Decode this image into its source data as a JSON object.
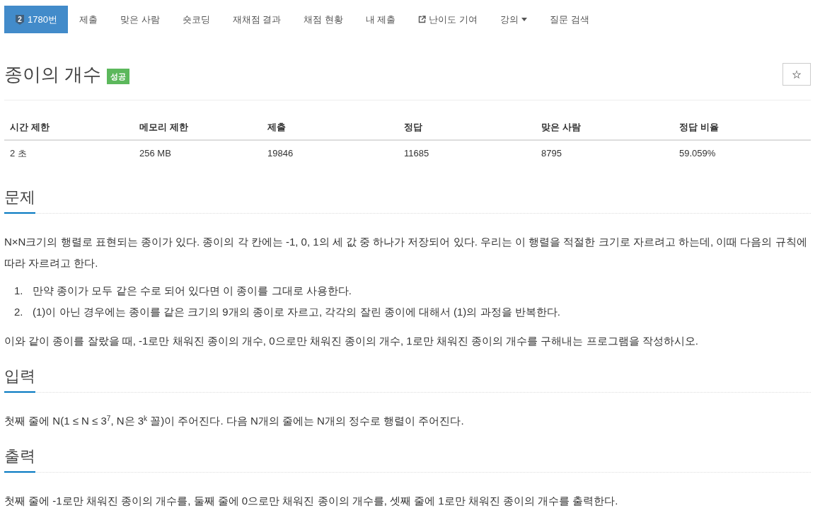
{
  "nav": {
    "tier": "2",
    "tabs": [
      {
        "label": "1780번",
        "kind": "problem",
        "selected": true
      },
      {
        "label": "제출",
        "kind": "link",
        "selected": false
      },
      {
        "label": "맞은 사람",
        "kind": "link",
        "selected": false
      },
      {
        "label": "숏코딩",
        "kind": "link",
        "selected": false
      },
      {
        "label": "재채점 결과",
        "kind": "link",
        "selected": false
      },
      {
        "label": "채점 현황",
        "kind": "link",
        "selected": false
      },
      {
        "label": "내 제출",
        "kind": "link",
        "selected": false
      },
      {
        "label": "난이도 기여",
        "kind": "external",
        "selected": false
      },
      {
        "label": "강의",
        "kind": "dropdown",
        "selected": false
      },
      {
        "label": "질문 검색",
        "kind": "link",
        "selected": false
      }
    ]
  },
  "problem": {
    "title": "종이의 개수",
    "result": "성공",
    "star": "☆"
  },
  "limits": {
    "columns": [
      "시간 제한",
      "메모리 제한",
      "제출",
      "정답",
      "맞은 사람",
      "정답 비율"
    ],
    "rows": [
      [
        "2 초",
        "256 MB",
        "19846",
        "11685",
        "8795",
        "59.059%"
      ]
    ]
  },
  "sections": [
    {
      "heading": "문제",
      "blocks": [
        {
          "kind": "paragraph",
          "text": "N×N크기의 행렬로 표현되는 종이가 있다. 종이의 각 칸에는 -1, 0, 1의 세 값 중 하나가 저장되어 있다. 우리는 이 행렬을 적절한 크기로 자르려고 하는데, 이때 다음의 규칙에 따라 자르려고 한다."
        },
        {
          "kind": "ordered_list",
          "items": [
            {
              "number": "1.",
              "text": "만약 종이가 모두 같은 수로 되어 있다면 이 종이를 그대로 사용한다."
            },
            {
              "number": "2.",
              "text": "(1)이 아닌 경우에는 종이를 같은 크기의 9개의 종이로 자르고, 각각의 잘린 종이에 대해서 (1)의 과정을 반복한다."
            }
          ]
        },
        {
          "kind": "paragraph",
          "text": "이와 같이 종이를 잘랐을 때, -1로만 채워진 종이의 개수, 0으로만 채워진 종이의 개수, 1로만 채워진 종이의 개수를 구해내는 프로그램을 작성하시오."
        }
      ]
    },
    {
      "heading": "입력",
      "blocks": [
        {
          "kind": "paragraph",
          "text": "첫째 줄에 N(1 ≤ N ≤ 3$^{7}$, N은 3$^{k}$ 꼴)이 주어진다. 다음 N개의 줄에는 N개의 정수로 행렬이 주어진다."
        }
      ]
    },
    {
      "heading": "출력",
      "blocks": [
        {
          "kind": "paragraph",
          "text": "첫째 줄에 -1로만 채워진 종이의 개수를, 둘째 줄에 0으로만 채워진 종이의 개수를, 셋째 줄에 1로만 채워진 종이의 개수를 출력한다."
        }
      ]
    }
  ]
}
